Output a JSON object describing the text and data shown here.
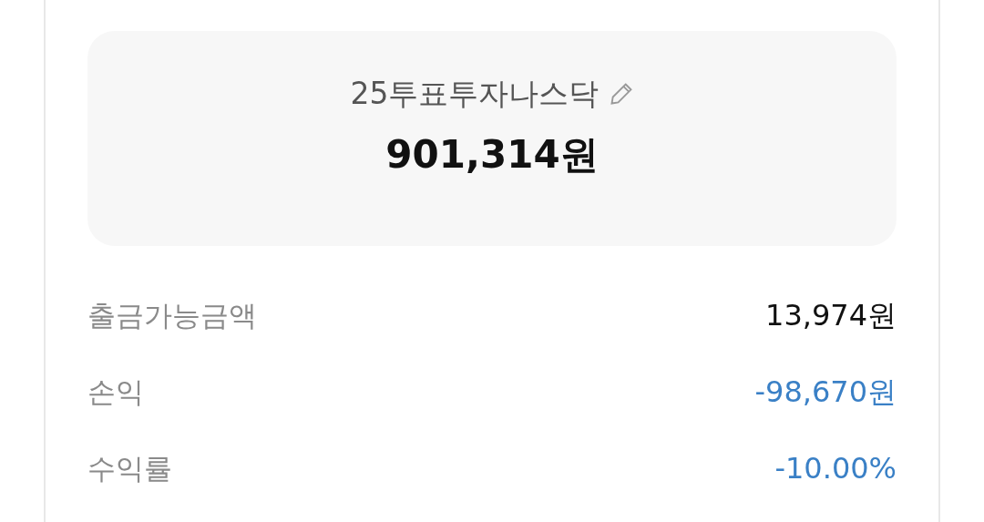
{
  "account": {
    "name": "25투표투자나스닥",
    "total": "901,314원"
  },
  "rows": [
    {
      "label": "출금가능금액",
      "value": "13,974원",
      "kind": "plain"
    },
    {
      "label": "손익",
      "value": "-98,670원",
      "kind": "loss"
    },
    {
      "label": "수익률",
      "value": "-10.00%",
      "kind": "loss"
    }
  ]
}
